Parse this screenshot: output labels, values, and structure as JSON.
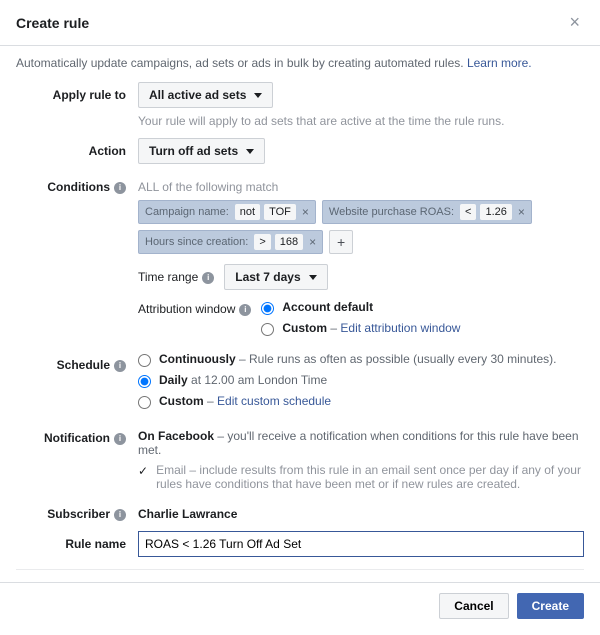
{
  "header": {
    "title": "Create rule",
    "description": "Automatically update campaigns, ad sets or ads in bulk by creating automated rules.",
    "learn_more": "Learn more."
  },
  "labels": {
    "apply_rule_to": "Apply rule to",
    "action": "Action",
    "conditions": "Conditions",
    "schedule": "Schedule",
    "notification": "Notification",
    "subscriber": "Subscriber",
    "rule_name": "Rule name",
    "time_range": "Time range",
    "attribution_window": "Attribution window"
  },
  "apply_rule": {
    "selected": "All active ad sets",
    "help": "Your rule will apply to ad sets that are active at the time the rule runs."
  },
  "action": {
    "selected": "Turn off ad sets"
  },
  "conditions": {
    "match_text": "ALL of the following match",
    "chips": [
      {
        "label": "Campaign name:",
        "op": "not",
        "val": "TOF"
      },
      {
        "label": "Website purchase ROAS:",
        "op": "<",
        "val": "1.26"
      },
      {
        "label": "Hours since creation:",
        "op": ">",
        "val": "168"
      }
    ],
    "time_range_selected": "Last 7 days"
  },
  "attribution": {
    "options": [
      {
        "label": "Account default",
        "desc": "",
        "link": ""
      },
      {
        "label": "Custom",
        "desc": "",
        "link": "Edit attribution window"
      }
    ]
  },
  "schedule": {
    "options": [
      {
        "label": "Continuously",
        "desc": " – Rule runs as often as possible (usually every 30 minutes).",
        "link": ""
      },
      {
        "label": "Daily",
        "desc": " at 12.00 am London Time",
        "link": ""
      },
      {
        "label": "Custom",
        "desc": " – ",
        "link": "Edit custom schedule"
      }
    ]
  },
  "notification": {
    "facebook_label": "On Facebook",
    "facebook_desc": " – you'll receive a notification when conditions for this rule have been met.",
    "email_label": "Email",
    "email_desc": " – include results from this rule in an email sent once per day if any of your rules have conditions that have been met or if new rules are created."
  },
  "subscriber": "Charlie Lawrance",
  "rule_name_value": "ROAS < 1.26 Turn Off Ad Set",
  "footer": {
    "cancel": "Cancel",
    "create": "Create"
  }
}
